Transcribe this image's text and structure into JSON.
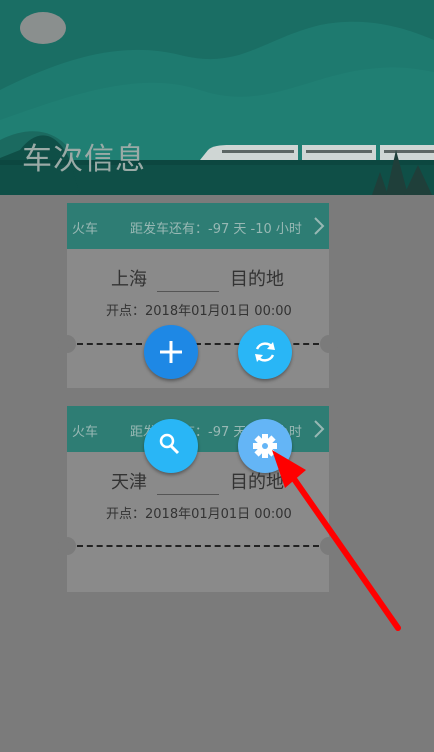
{
  "header": {
    "title": "车次信息",
    "bg_color": "#1a6e64"
  },
  "tickets": [
    {
      "type": "火车",
      "countdown": "距发车还有：-97 天 -10 小时",
      "from": "上海",
      "to": "目的地",
      "depart": "开点：2018年01月01日   00:00"
    },
    {
      "type": "火车",
      "countdown": "距发车还有：-97 天 -10 小时",
      "from": "天津",
      "to": "目的地",
      "depart": "开点：2018年01月01日   00:00"
    }
  ],
  "fabs": [
    {
      "icon": "plus-icon",
      "color": "#1e88e5"
    },
    {
      "icon": "refresh-icon",
      "color": "#29b6f6"
    },
    {
      "icon": "search-icon",
      "color": "#29b6f6"
    },
    {
      "icon": "settings-icon",
      "color": "#64b5f6"
    }
  ],
  "annotation": {
    "icon": "red-arrow-pointer",
    "color": "#ff0000"
  }
}
